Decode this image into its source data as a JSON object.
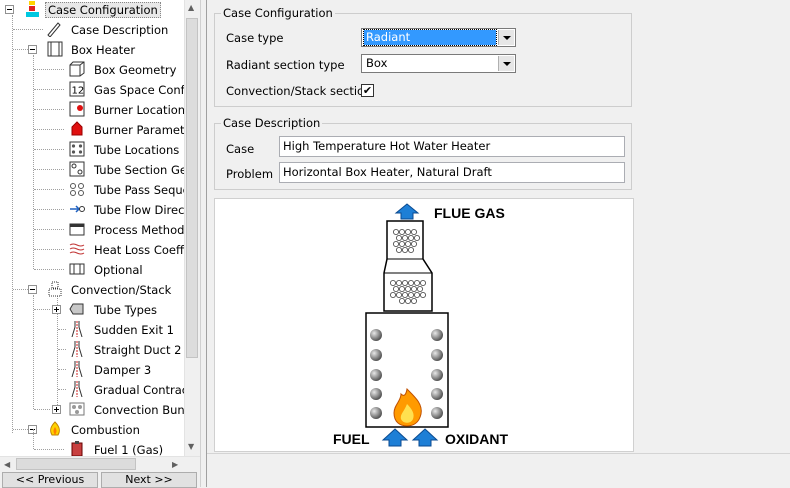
{
  "tree": {
    "items": [
      {
        "label": "Case Configuration",
        "selected": true,
        "icon": "case-configuration-icon"
      },
      {
        "label": "Case Description",
        "icon": "pen-icon"
      },
      {
        "label": "Box Heater",
        "icon": "box-heater-icon"
      },
      {
        "label": "Box Geometry",
        "icon": "box-geometry-icon"
      },
      {
        "label": "Gas Space Configu",
        "icon": "gas-space-icon"
      },
      {
        "label": "Burner Locations",
        "icon": "burner-locations-icon"
      },
      {
        "label": "Burner Paramete",
        "icon": "burner-parameters-icon"
      },
      {
        "label": "Tube Locations",
        "icon": "tube-locations-icon"
      },
      {
        "label": "Tube Section Geo",
        "icon": "tube-section-icon"
      },
      {
        "label": "Tube Pass Seque",
        "icon": "tube-pass-icon"
      },
      {
        "label": "Tube Flow Direct",
        "icon": "tube-flow-icon"
      },
      {
        "label": "Process Methods",
        "icon": "process-methods-icon"
      },
      {
        "label": "Heat Loss Coeffic",
        "icon": "heat-loss-icon"
      },
      {
        "label": "Optional",
        "icon": "optional-icon"
      },
      {
        "label": "Convection/Stack",
        "icon": "convection-stack-icon"
      },
      {
        "label": "Tube Types",
        "icon": "tube-types-icon"
      },
      {
        "label": "Sudden Exit 1",
        "icon": "duct-icon"
      },
      {
        "label": "Straight Duct 2",
        "icon": "duct-icon"
      },
      {
        "label": "Damper 3",
        "icon": "duct-icon"
      },
      {
        "label": "Gradual Contract",
        "icon": "duct-icon"
      },
      {
        "label": "Convection Bunc",
        "icon": "convection-bundle-icon"
      },
      {
        "label": "Combustion",
        "icon": "combustion-icon"
      },
      {
        "label": "Fuel 1 (Gas)",
        "icon": "fuel-icon"
      }
    ]
  },
  "nav": {
    "previous": "<< Previous",
    "next": "Next >>"
  },
  "case_configuration": {
    "title": "Case Configuration",
    "case_type_label": "Case type",
    "case_type_value": "Radiant",
    "radiant_section_type_label": "Radiant section type",
    "radiant_section_type_value": "Box",
    "convection_stack_label": "Convection/Stack section",
    "convection_stack_checked": true,
    "check_mark": "✔"
  },
  "case_description": {
    "title": "Case Description",
    "case_label": "Case",
    "case_value": "High Temperature Hot Water Heater",
    "problem_label": "Problem",
    "problem_value": "Horizontal Box Heater, Natural Draft"
  },
  "diagram": {
    "flue_gas_label": "FLUE GAS",
    "fuel_label": "FUEL",
    "oxidant_label": "OXIDANT",
    "arrow_color": "#1e7fd6",
    "tube_color": "#8a8a8a"
  }
}
